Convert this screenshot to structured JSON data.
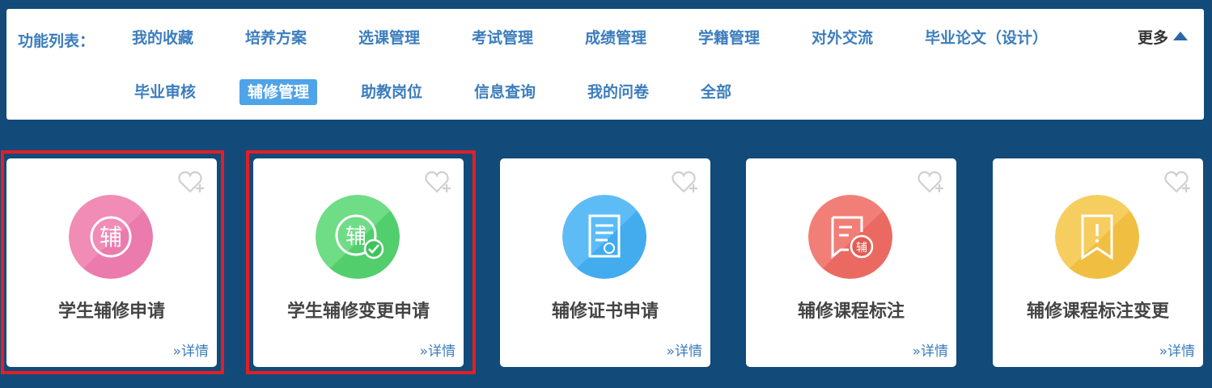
{
  "menu": {
    "label": "功能列表：",
    "more": "更多",
    "row1": [
      "我的收藏",
      "培养方案",
      "选课管理",
      "考试管理",
      "成绩管理",
      "学籍管理",
      "对外交流",
      "毕业论文（设计）"
    ],
    "row2": [
      "毕业审核",
      "辅修管理",
      "助教岗位",
      "信息查询",
      "我的问卷",
      "全部"
    ],
    "active": "辅修管理"
  },
  "cards": [
    {
      "title": "学生辅修申请",
      "detail": "»详情",
      "icon": "minor-char-icon",
      "color": "#ee7fae",
      "highlighted": true
    },
    {
      "title": "学生辅修变更申请",
      "detail": "»详情",
      "icon": "minor-change-check-icon",
      "color": "#4cd06a",
      "highlighted": true
    },
    {
      "title": "辅修证书申请",
      "detail": "»详情",
      "icon": "certificate-document-icon",
      "color": "#3fa9f1",
      "highlighted": false
    },
    {
      "title": "辅修课程标注",
      "detail": "»详情",
      "icon": "course-annotation-icon",
      "color": "#ee6f66",
      "highlighted": false
    },
    {
      "title": "辅修课程标注变更",
      "detail": "»详情",
      "icon": "bookmark-alert-icon",
      "color": "#f2c24d",
      "highlighted": false
    }
  ],
  "icon_glyphs": {
    "minor_char": "辅"
  },
  "colors": {
    "background": "#124a7a",
    "accent": "#3c7dbd",
    "active_tab": "#4fa3e8",
    "highlight_border": "#e21f26"
  }
}
